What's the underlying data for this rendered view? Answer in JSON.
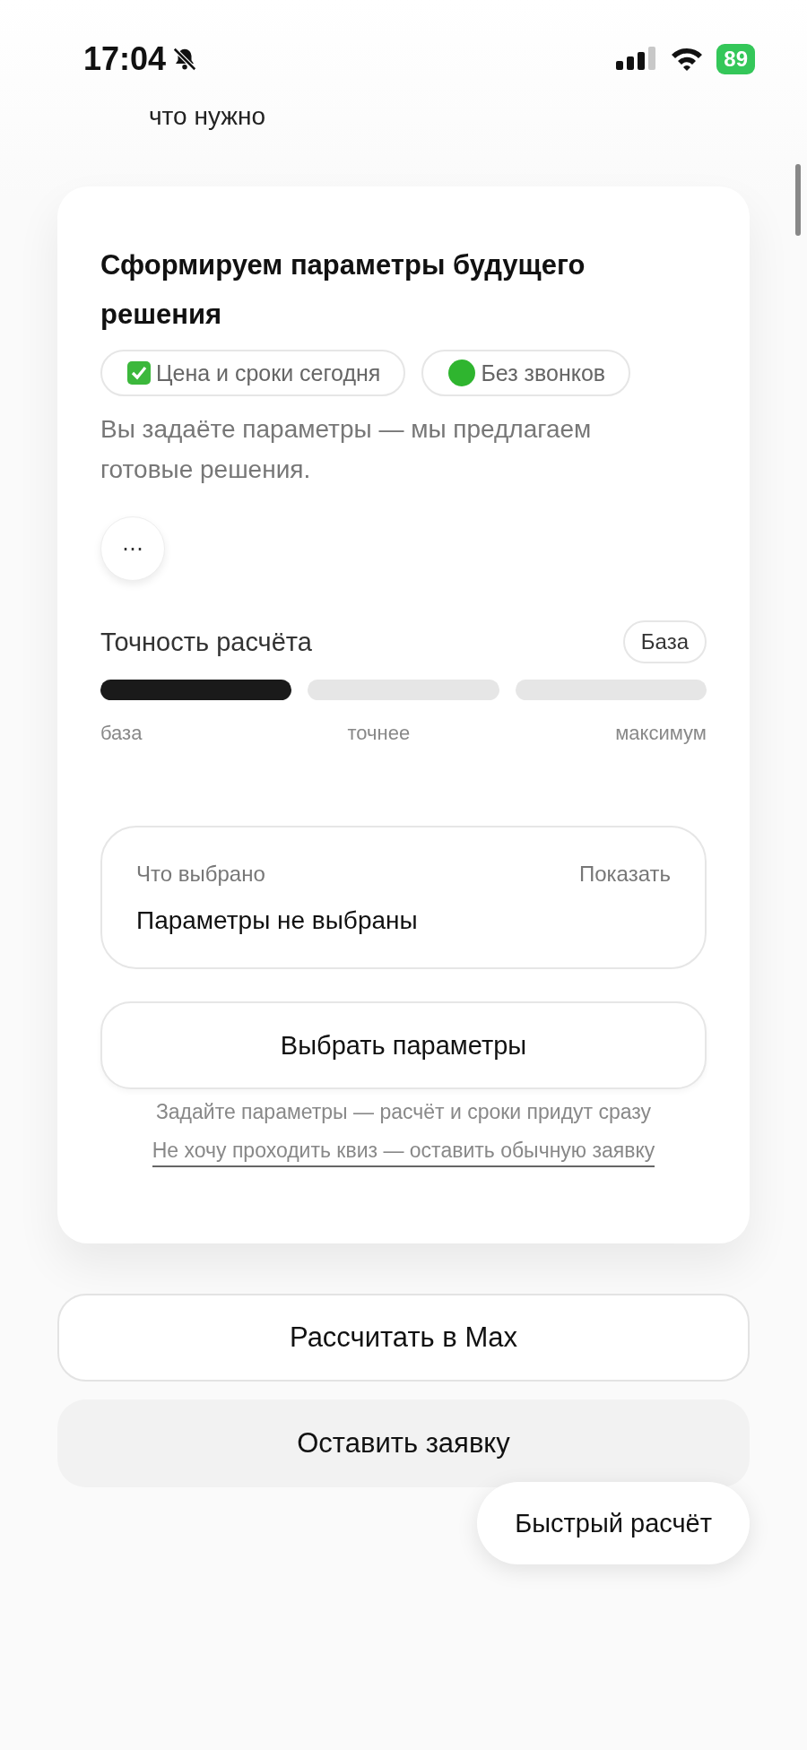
{
  "status_bar": {
    "time": "17:04",
    "silent": true,
    "battery": "89"
  },
  "previous_text": "что нужно",
  "card": {
    "title": "Сформируем параметры будущего решения",
    "chips": [
      {
        "kind": "check",
        "label": "Цена и сроки сегодня"
      },
      {
        "kind": "dot",
        "color": "#2fb52f",
        "label": "Без звонков"
      }
    ],
    "description": "Вы задаёте параметры — мы предлагаем готовые решения.",
    "more_button": "⋯",
    "accuracy": {
      "label": "Точность расчёта",
      "badge": "База",
      "steps": [
        {
          "label": "база",
          "selected": true
        },
        {
          "label": "точнее",
          "selected": false
        },
        {
          "label": "максимум",
          "selected": false
        }
      ]
    },
    "summary": {
      "label": "Что выбрано",
      "action": "Показать",
      "value": "Параметры не выбраны"
    },
    "primary_button": "Выбрать параметры",
    "hint": "Задайте параметры — расчёт и сроки придут сразу",
    "link": "Не хочу проходить квиз — оставить обычную заявку"
  },
  "buttons": [
    {
      "kind": "outline",
      "label": "Рассчитать в Max"
    },
    {
      "kind": "filled",
      "label": "Оставить заявку"
    }
  ],
  "floating_button": "Быстрый расчёт"
}
